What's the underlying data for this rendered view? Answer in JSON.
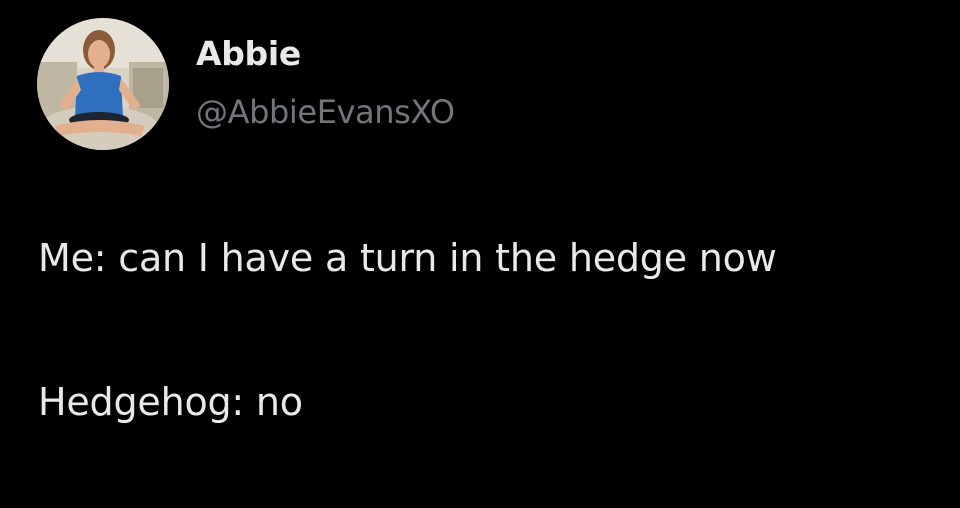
{
  "theme": {
    "background": "#000000",
    "text": "#e7e9ea",
    "secondary_text": "#71767b"
  },
  "author": {
    "avatar": "profile-photo",
    "display_name": "Abbie",
    "handle": "@AbbieEvansXO"
  },
  "tweet": {
    "lines": [
      "Me: can I have a turn in the hedge now",
      "Hedgehog: no"
    ]
  }
}
